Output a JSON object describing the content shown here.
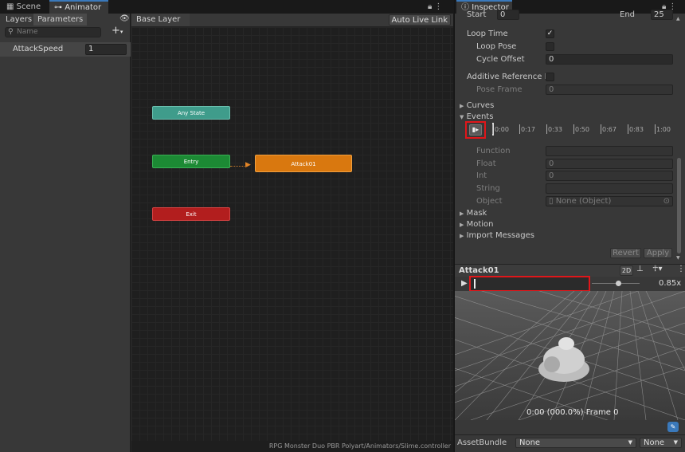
{
  "animator": {
    "tabs": [
      {
        "label": "Scene"
      },
      {
        "label": "Animator"
      }
    ],
    "subtabs": {
      "layers": "Layers",
      "parameters": "Parameters"
    },
    "search_placeholder": "Name",
    "parameters": [
      {
        "name": "AttackSpeed",
        "value": "1"
      }
    ],
    "breadcrumb": "Base Layer",
    "auto_live_link": "Auto Live Link",
    "states": {
      "any": "Any State",
      "entry": "Entry",
      "exit": "Exit",
      "attack": "Attack01"
    },
    "status_path": "RPG Monster Duo PBR Polyart/Animators/Slime.controller"
  },
  "inspector": {
    "tab_label": "Inspector",
    "start_label": "Start",
    "start_value": "0",
    "end_label": "End",
    "end_value": "25",
    "loop_time": "Loop Time",
    "loop_pose": "Loop Pose",
    "cycle_offset": "Cycle Offset",
    "cycle_offset_value": "0",
    "additive": "Additive Reference P",
    "pose_frame": "Pose Frame",
    "pose_frame_value": "0",
    "curves": "Curves",
    "events": "Events",
    "ruler": [
      "0:00",
      "0:17",
      "0:33",
      "0:50",
      "0:67",
      "0:83",
      "1:00"
    ],
    "event_fields": {
      "function": "Function",
      "float": "Float",
      "float_value": "0",
      "int": "Int",
      "int_value": "0",
      "string": "String",
      "object": "Object",
      "object_value": "None (Object)"
    },
    "mask": "Mask",
    "motion": "Motion",
    "import_messages": "Import Messages",
    "revert": "Revert",
    "apply": "Apply"
  },
  "preview": {
    "clip_name": "Attack01",
    "mode_2d": "2D",
    "speed": "0.85x",
    "frame_readout": "0:00 (000.0%) Frame 0"
  },
  "assetbundle": {
    "label": "AssetBundle",
    "name": "None",
    "variant": "None"
  },
  "colors": {
    "accent": "#3a79bb",
    "any_state": "#3f9c8b",
    "entry": "#1c8a34",
    "exit": "#b21e1e",
    "attack": "#d9780f",
    "highlight": "#e0161a"
  }
}
